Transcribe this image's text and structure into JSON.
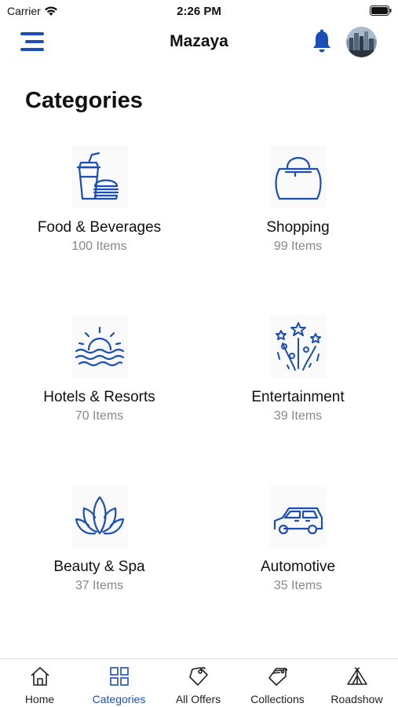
{
  "status_bar": {
    "carrier": "Carrier",
    "time": "2:26 PM"
  },
  "nav": {
    "title": "Mazaya",
    "menu_icon": "hamburger-icon",
    "bell_icon": "bell-icon",
    "avatar": "user-avatar"
  },
  "page": {
    "title": "Categories"
  },
  "colors": {
    "accent": "#1c4fb5",
    "text": "#111111",
    "muted": "#888888",
    "tab_border": "#dcdcdc"
  },
  "categories": [
    {
      "name": "Food & Beverages",
      "count": "100 Items",
      "icon": "food-beverage-icon"
    },
    {
      "name": "Shopping",
      "count": "99 Items",
      "icon": "shopping-bag-icon"
    },
    {
      "name": "Hotels & Resorts",
      "count": "70 Items",
      "icon": "sunset-sea-icon"
    },
    {
      "name": "Entertainment",
      "count": "39 Items",
      "icon": "fireworks-icon"
    },
    {
      "name": "Beauty & Spa",
      "count": "37 Items",
      "icon": "lotus-icon"
    },
    {
      "name": "Automotive",
      "count": "35 Items",
      "icon": "car-icon"
    }
  ],
  "tabs": [
    {
      "label": "Home",
      "icon": "home-icon",
      "active": false
    },
    {
      "label": "Categories",
      "icon": "grid-icon",
      "active": true
    },
    {
      "label": "All Offers",
      "icon": "tag-icon",
      "active": false
    },
    {
      "label": "Collections",
      "icon": "tags-stack-icon",
      "active": false
    },
    {
      "label": "Roadshow",
      "icon": "tent-icon",
      "active": false
    }
  ]
}
